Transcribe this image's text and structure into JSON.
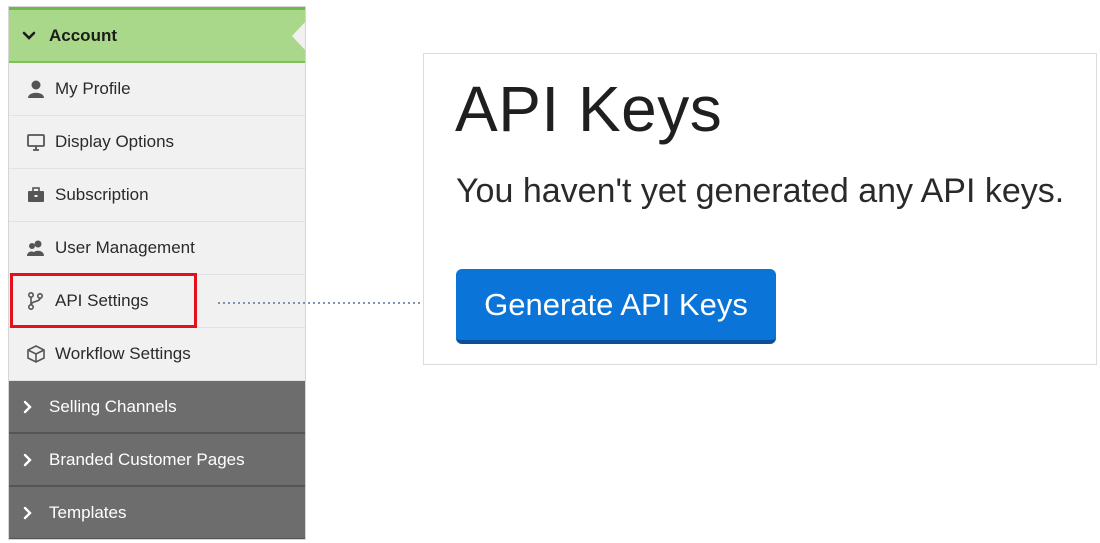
{
  "sidebar": {
    "section_title": "Account",
    "items": [
      {
        "label": "My Profile",
        "icon": "user-icon"
      },
      {
        "label": "Display Options",
        "icon": "monitor-icon"
      },
      {
        "label": "Subscription",
        "icon": "briefcase-icon"
      },
      {
        "label": "User Management",
        "icon": "users-icon"
      },
      {
        "label": "API Settings",
        "icon": "branch-icon"
      },
      {
        "label": "Workflow Settings",
        "icon": "cube-icon"
      }
    ],
    "collapsed_sections": [
      {
        "label": "Selling Channels"
      },
      {
        "label": "Branded Customer Pages"
      },
      {
        "label": "Templates"
      }
    ]
  },
  "panel": {
    "title": "API Keys",
    "message": "You haven't yet generated any API keys.",
    "button_label": "Generate API Keys"
  },
  "colors": {
    "header_green": "#a9d88a",
    "highlight_red": "#e3111b",
    "button_blue": "#0a74d8",
    "dark_section": "#6d6d6d"
  }
}
